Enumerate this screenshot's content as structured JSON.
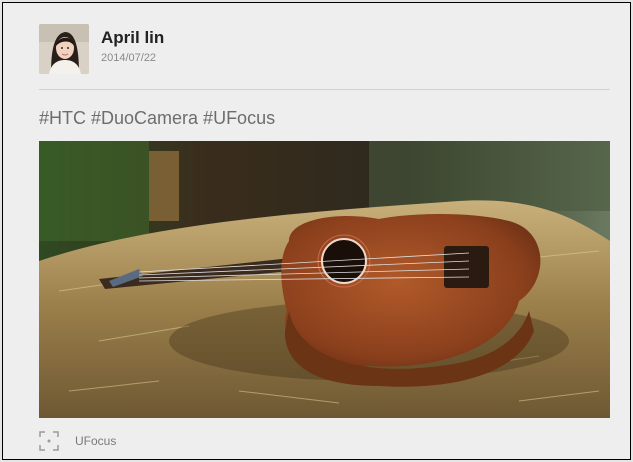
{
  "post": {
    "author_name": "April lin",
    "date": "2014/07/22",
    "caption": "#HTC #DuoCamera #UFocus",
    "photo_subject": "ukulele-photo",
    "footer": {
      "icon": "ufocus-icon",
      "label": "UFocus"
    }
  },
  "colors": {
    "card_background": "#eeeeee",
    "author_text": "#222222",
    "date_text": "#8a8a8a",
    "caption_text": "#6d6d6d",
    "ukulele_wood": "#8a3f1c"
  }
}
